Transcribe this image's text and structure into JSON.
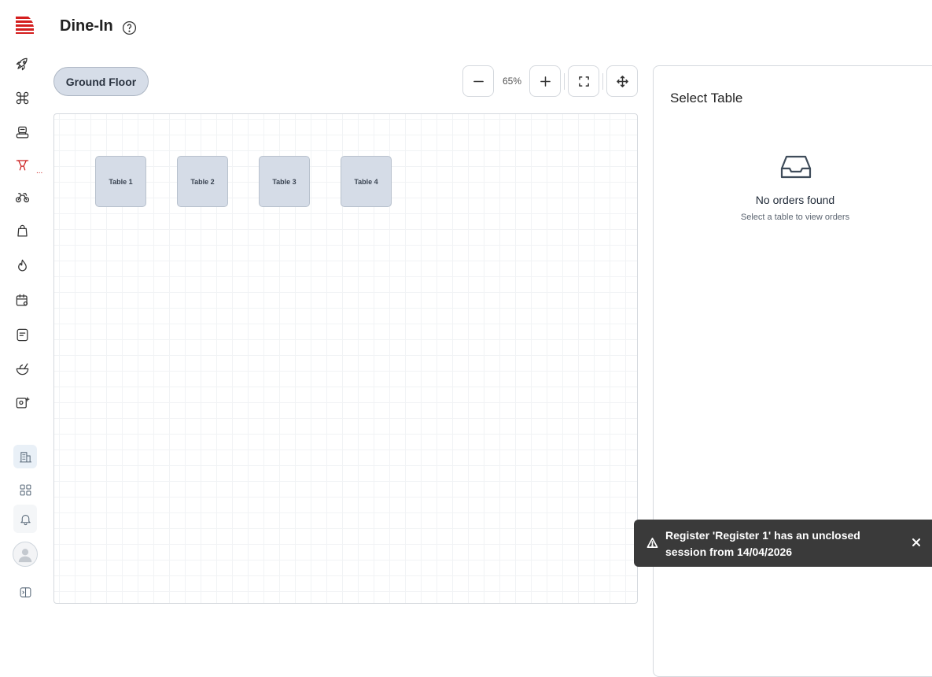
{
  "header": {
    "title": "Dine-In"
  },
  "sidebar": {
    "icons": [
      "logo-icon",
      "rocket-icon",
      "command-icon",
      "register-icon",
      "dine-in-icon",
      "delivery-bike-icon",
      "bag-icon",
      "flame-icon",
      "calendar-settings-icon",
      "receipt-icon",
      "food-bowl-icon",
      "add-image-icon",
      "building-icon",
      "grid-icon",
      "bell-icon",
      "avatar-icon",
      "sidebar-toggle-icon"
    ],
    "accent_color": "#cc1f1f",
    "active_indicator": "..."
  },
  "floors": [
    {
      "label": "Ground Floor",
      "selected": true
    }
  ],
  "zoom": {
    "level": "65%"
  },
  "tables": [
    {
      "label": "Table 1"
    },
    {
      "label": "Table 2"
    },
    {
      "label": "Table 3"
    },
    {
      "label": "Table 4"
    }
  ],
  "panel": {
    "title": "Select Table",
    "empty_title": "No orders found",
    "empty_subtitle": "Select a table to view orders"
  },
  "toast": {
    "message": "Register 'Register 1' has an unclosed session from 14/04/2026"
  }
}
